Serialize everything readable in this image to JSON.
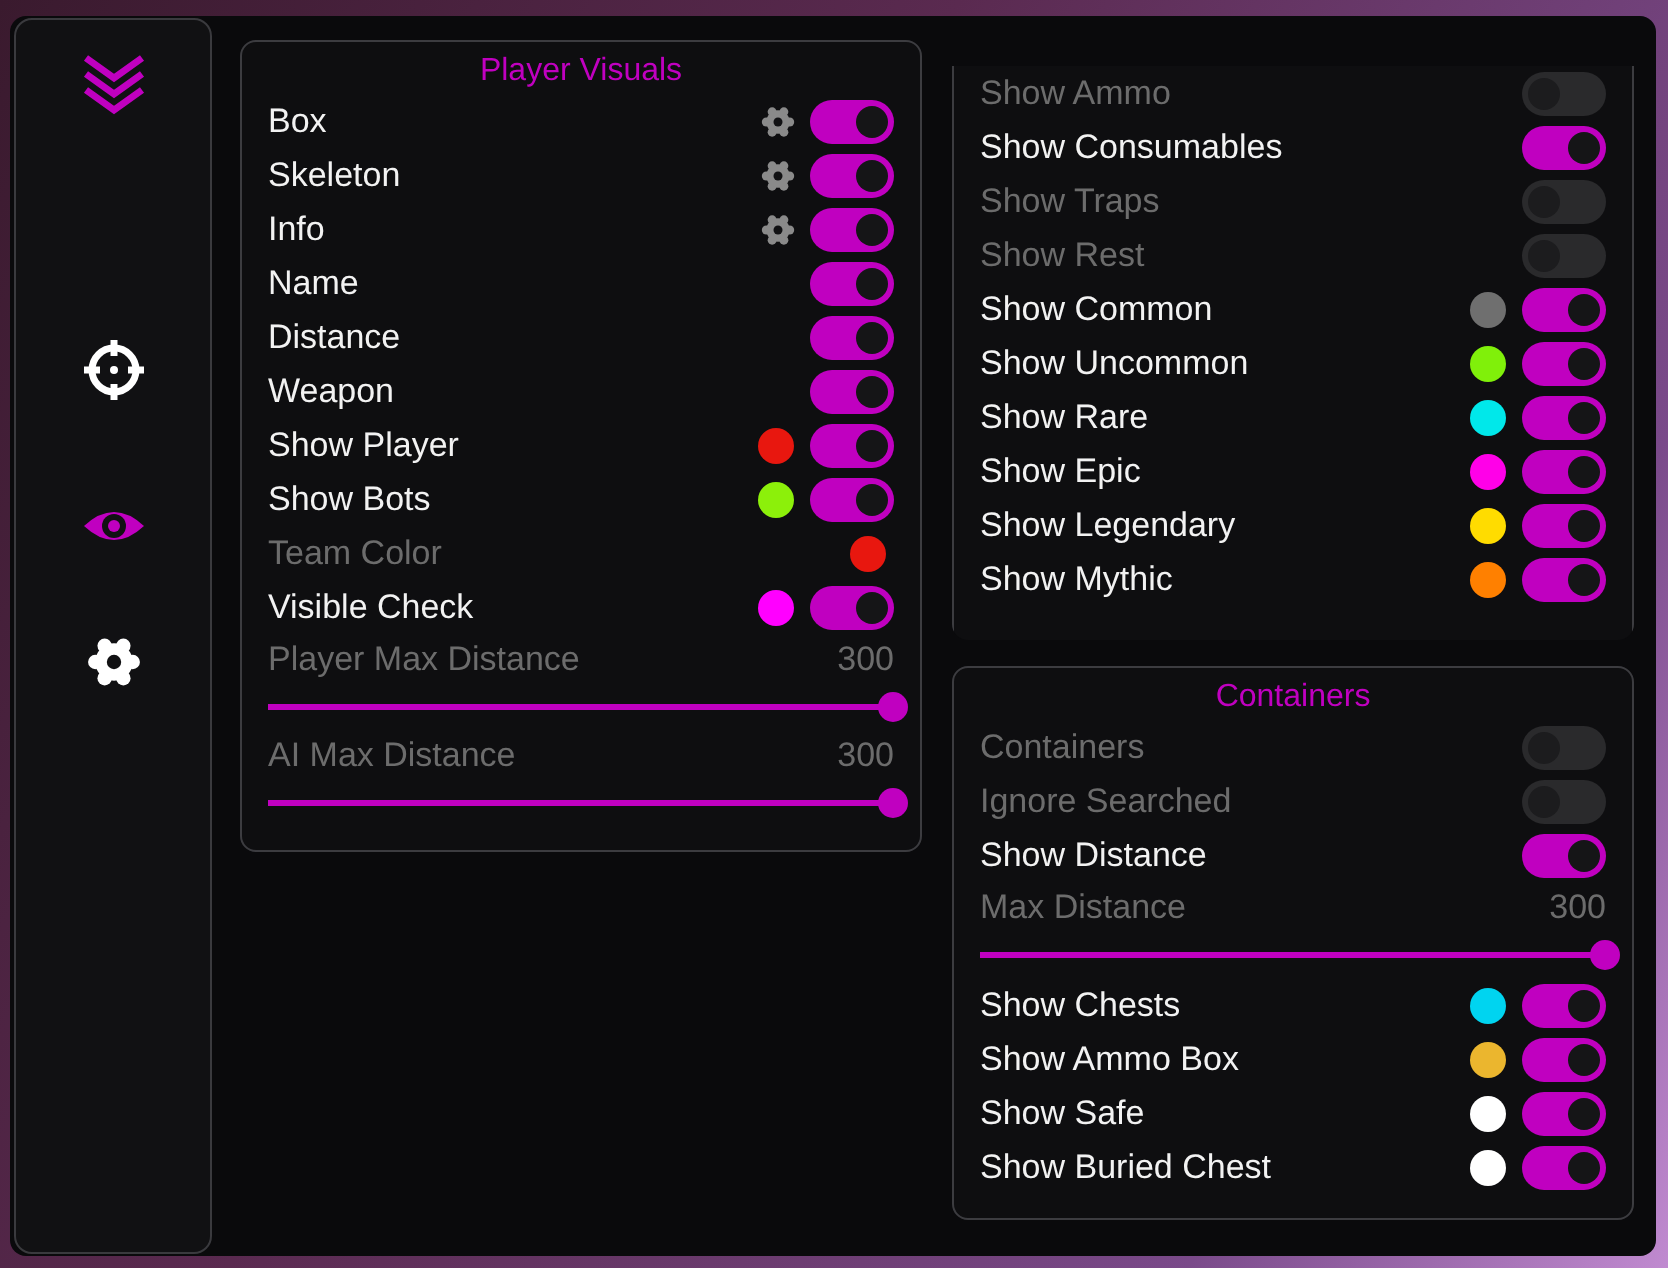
{
  "sidebar": {
    "items": [
      {
        "kind": "aim",
        "selected": false
      },
      {
        "kind": "visuals",
        "selected": true
      },
      {
        "kind": "settings",
        "selected": false
      }
    ]
  },
  "panels": [
    {
      "title": "Player Visuals",
      "rows": [
        {
          "kind": "toggle",
          "label": "Box",
          "on": true,
          "gear": true
        },
        {
          "kind": "toggle",
          "label": "Skeleton",
          "on": true,
          "gear": true
        },
        {
          "kind": "toggle",
          "label": "Info",
          "on": true,
          "gear": true
        },
        {
          "kind": "toggle",
          "label": "Name",
          "on": true
        },
        {
          "kind": "toggle",
          "label": "Distance",
          "on": true
        },
        {
          "kind": "toggle",
          "label": "Weapon",
          "on": true
        },
        {
          "kind": "toggle",
          "label": "Show Player",
          "on": true,
          "color": "#e8170f"
        },
        {
          "kind": "toggle",
          "label": "Show Bots",
          "on": true,
          "color": "#8cf00a"
        },
        {
          "kind": "color",
          "label": "Team Color",
          "disabled": true,
          "color": "#e8170f"
        },
        {
          "kind": "toggle",
          "label": "Visible Check",
          "on": true,
          "color": "#ff00ff"
        },
        {
          "kind": "slider",
          "label": "Player Max Distance",
          "value": "300",
          "level": 1
        },
        {
          "kind": "slider",
          "label": "AI Max Distance",
          "value": "300",
          "level": 1
        }
      ]
    },
    {
      "rows": [
        {
          "kind": "toggle",
          "label": "Show Ammo",
          "on": false
        },
        {
          "kind": "toggle",
          "label": "Show Consumables",
          "on": true
        },
        {
          "kind": "toggle",
          "label": "Show Traps",
          "on": false
        },
        {
          "kind": "toggle",
          "label": "Show Rest",
          "on": false
        },
        {
          "kind": "toggle",
          "label": "Show Common",
          "on": true,
          "color": "#6f6f6f"
        },
        {
          "kind": "toggle",
          "label": "Show Uncommon",
          "on": true,
          "color": "#80f00a"
        },
        {
          "kind": "toggle",
          "label": "Show Rare",
          "on": true,
          "color": "#00e8ea"
        },
        {
          "kind": "toggle",
          "label": "Show Epic",
          "on": true,
          "color": "#ff00e8"
        },
        {
          "kind": "toggle",
          "label": "Show Legendary",
          "on": true,
          "color": "#ffdc00"
        },
        {
          "kind": "toggle",
          "label": "Show Mythic",
          "on": true,
          "color": "#ff8000"
        }
      ]
    },
    {
      "title": "Containers",
      "rows": [
        {
          "kind": "toggle",
          "label": "Containers",
          "on": false
        },
        {
          "kind": "toggle",
          "label": "Ignore Searched",
          "on": false
        },
        {
          "kind": "toggle",
          "label": "Show Distance",
          "on": true
        },
        {
          "kind": "slider",
          "label": "Max Distance",
          "value": "300",
          "level": 1
        },
        {
          "kind": "toggle",
          "label": "Show Chests",
          "on": true,
          "color": "#00d4f0"
        },
        {
          "kind": "toggle",
          "label": "Show Ammo Box",
          "on": true,
          "color": "#ebb62e"
        },
        {
          "kind": "toggle",
          "label": "Show Safe",
          "on": true,
          "color": "#ffffff"
        },
        {
          "kind": "toggle",
          "label": "Show Buried Chest",
          "on": true,
          "color": "#ffffff"
        }
      ]
    }
  ]
}
